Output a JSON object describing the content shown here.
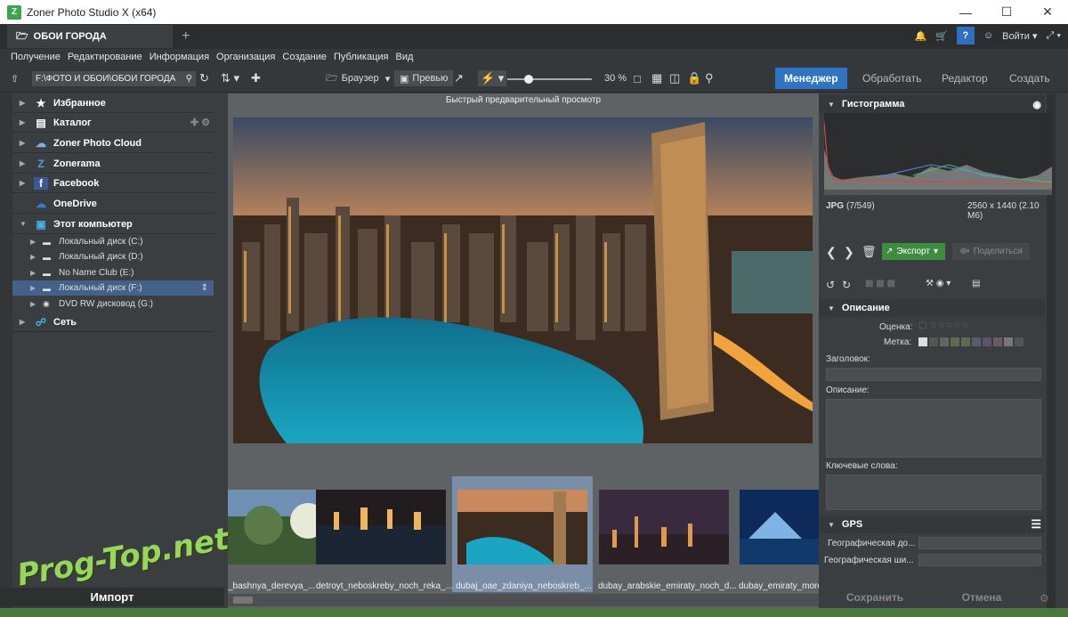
{
  "window": {
    "title": "Zoner Photo Studio X (x64)",
    "app_icon": "Z"
  },
  "tabbar": {
    "tab_title": "ОБОИ ГОРОДА",
    "account_label": "Войти"
  },
  "menu": [
    "Получение",
    "Редактирование",
    "Информация",
    "Организация",
    "Создание",
    "Публикация",
    "Вид"
  ],
  "toolbar": {
    "path": "F:\\ФОТО И ОБОИ\\ОБОИ ГОРОДА",
    "browser_label": "Браузер",
    "preview_label": "Превью",
    "zoom": "30 %",
    "modes": [
      {
        "label": "Менеджер",
        "active": true
      },
      {
        "label": "Обработать",
        "active": false
      },
      {
        "label": "Редактор",
        "active": false
      },
      {
        "label": "Создать",
        "active": false
      }
    ]
  },
  "left_panel": {
    "nav": [
      {
        "label": "Избранное",
        "icon": "star-icon"
      },
      {
        "label": "Каталог",
        "icon": "catalog-icon"
      },
      {
        "label": "Zoner Photo Cloud",
        "icon": "cloud-icon"
      },
      {
        "label": "Zonerama",
        "icon": "zonerama-icon"
      },
      {
        "label": "Facebook",
        "icon": "facebook-icon"
      },
      {
        "label": "OneDrive",
        "icon": "onedrive-icon"
      },
      {
        "label": "Этот компьютер",
        "icon": "computer-icon"
      }
    ],
    "drives": [
      {
        "label": "Локальный диск (C:)",
        "selected": false
      },
      {
        "label": "Локальный диск (D:)",
        "selected": false
      },
      {
        "label": "No Name Club (E:)",
        "selected": false
      },
      {
        "label": "Локальный диск (F:)",
        "selected": true
      },
      {
        "label": "DVD RW дисковод (G:)",
        "selected": false
      }
    ],
    "network": "Сеть",
    "import_label": "Импорт"
  },
  "center": {
    "caption": "Быстрый предварительный просмотр",
    "thumbnails": [
      {
        "label": "_bashnya_derevya_..."
      },
      {
        "label": "detroyt_neboskreby_noch_reka_..."
      },
      {
        "label": "dubaj_oae_zdaniya_neboskreb_...",
        "selected": true
      },
      {
        "label": "dubay_arabskie_emiraty_noch_d..."
      },
      {
        "label": "dubay_emiraty_more..."
      }
    ]
  },
  "right_panel": {
    "histogram_title": "Гистограмма",
    "file_type": "JPG",
    "file_index": "(7/549)",
    "file_dims": "2560 x 1440 (2.10 M6)",
    "export_label": "Экспорт",
    "share_label": "Поделиться",
    "description_title": "Описание",
    "rating_label": "Оценка:",
    "tag_label": "Метка:",
    "title_label": "Заголовок:",
    "description_label": "Описание:",
    "keywords_label": "Ключевые слова:",
    "gps_title": "GPS",
    "geo_lat": "Географическая до...",
    "geo_lon": "Географическая ши...",
    "save_label": "Сохранить",
    "cancel_label": "Отмена"
  },
  "watermark": "Prog-Top.net",
  "colors": {
    "accent": "#2f73c3",
    "export_green": "#3d8c3f",
    "selection": "#44618a"
  }
}
